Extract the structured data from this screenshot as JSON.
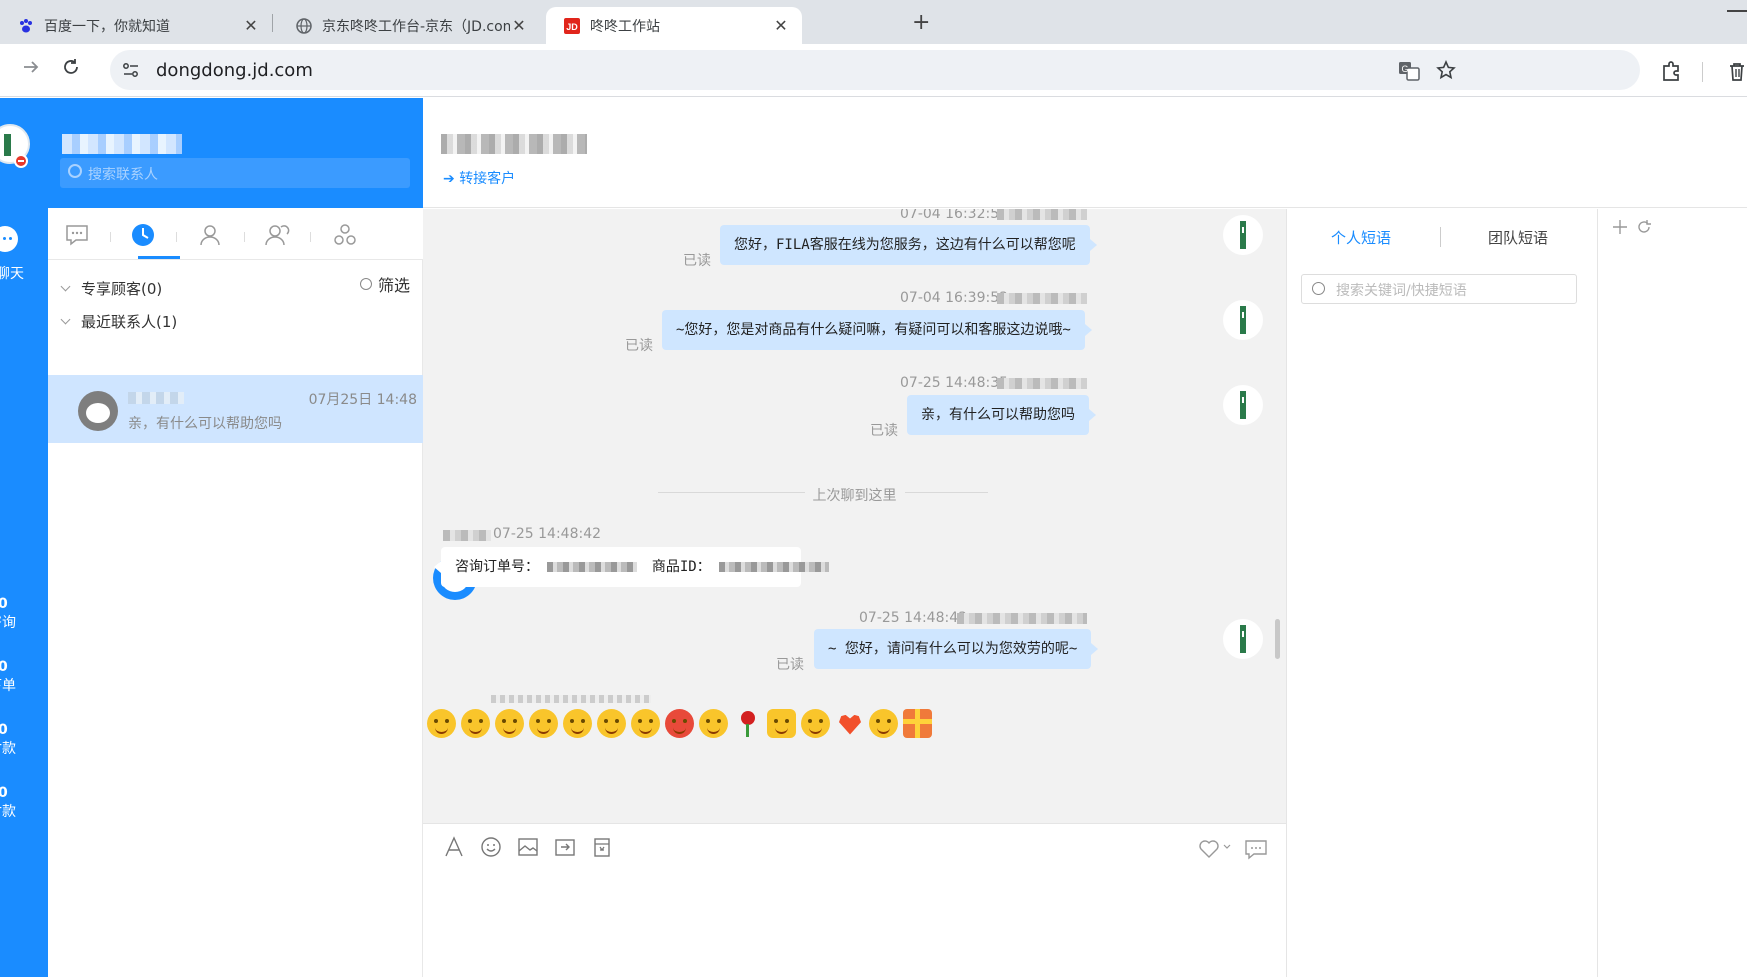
{
  "browser": {
    "tabs": [
      {
        "title": "百度一下，你就知道",
        "active": false
      },
      {
        "title": "京东咚咚工作台-京东（JD.com）",
        "active": false
      },
      {
        "title": "咚咚工作站",
        "active": true
      }
    ],
    "new_tab_label": "+",
    "close_label": "✕",
    "url": "dongdong.jd.com"
  },
  "rail": {
    "chat_label": "聊天",
    "stats": [
      {
        "count": "0",
        "label": "咨询"
      },
      {
        "count": "0",
        "label": "下单"
      },
      {
        "count": "0",
        "label": "付款"
      },
      {
        "count": "0",
        "label": "付款"
      }
    ]
  },
  "contacts": {
    "search_placeholder": "搜索联系人",
    "filter_label": "筛选",
    "groups": [
      {
        "label": "专享顾客(0)"
      },
      {
        "label": "最近联系人(1)"
      }
    ],
    "items": [
      {
        "time": "07月25日 14:48",
        "preview": "亲，有什么可以帮助您吗"
      }
    ]
  },
  "chat": {
    "transfer_label": "转接客户",
    "last_chat_divider": "上次聊到这里",
    "read_label": "已读",
    "messages": [
      {
        "direction": "out",
        "time": "07-04 16:32:55",
        "text": "您好，FILA客服在线为您服务，这边有什么可以帮您呢"
      },
      {
        "direction": "out",
        "time": "07-04 16:39:53",
        "text": "~您好，您是对商品有什么疑问嘛，有疑问可以和客服这边说哦~"
      },
      {
        "direction": "out",
        "time": "07-25 14:48:35",
        "text": "亲，有什么可以帮助您吗"
      },
      {
        "direction": "in",
        "time": "07-25 14:48:42",
        "order_label": "咨询订单号：",
        "product_label": "商品ID："
      },
      {
        "direction": "out",
        "time": "07-25 14:48:43",
        "text": "~ 您好，请问有什么可以为您效劳的呢~"
      }
    ],
    "emoji": [
      "tongue",
      "hmm",
      "wink",
      "victory",
      "handshake",
      "smile",
      "cool",
      "angry",
      "blush",
      "rose",
      "thumbs-up",
      "dizzy",
      "heart",
      "moved",
      "gift"
    ]
  },
  "phrases": {
    "tabs": [
      {
        "label": "个人短语",
        "active": true
      },
      {
        "label": "团队短语",
        "active": false
      }
    ],
    "search_placeholder": "搜索关键词/快捷短语"
  },
  "colors": {
    "brand_blue": "#1a8cff",
    "outgoing_bubble": "#cfe6ff",
    "selected_row": "#cfe5ff",
    "jd_red": "#e1251b"
  }
}
